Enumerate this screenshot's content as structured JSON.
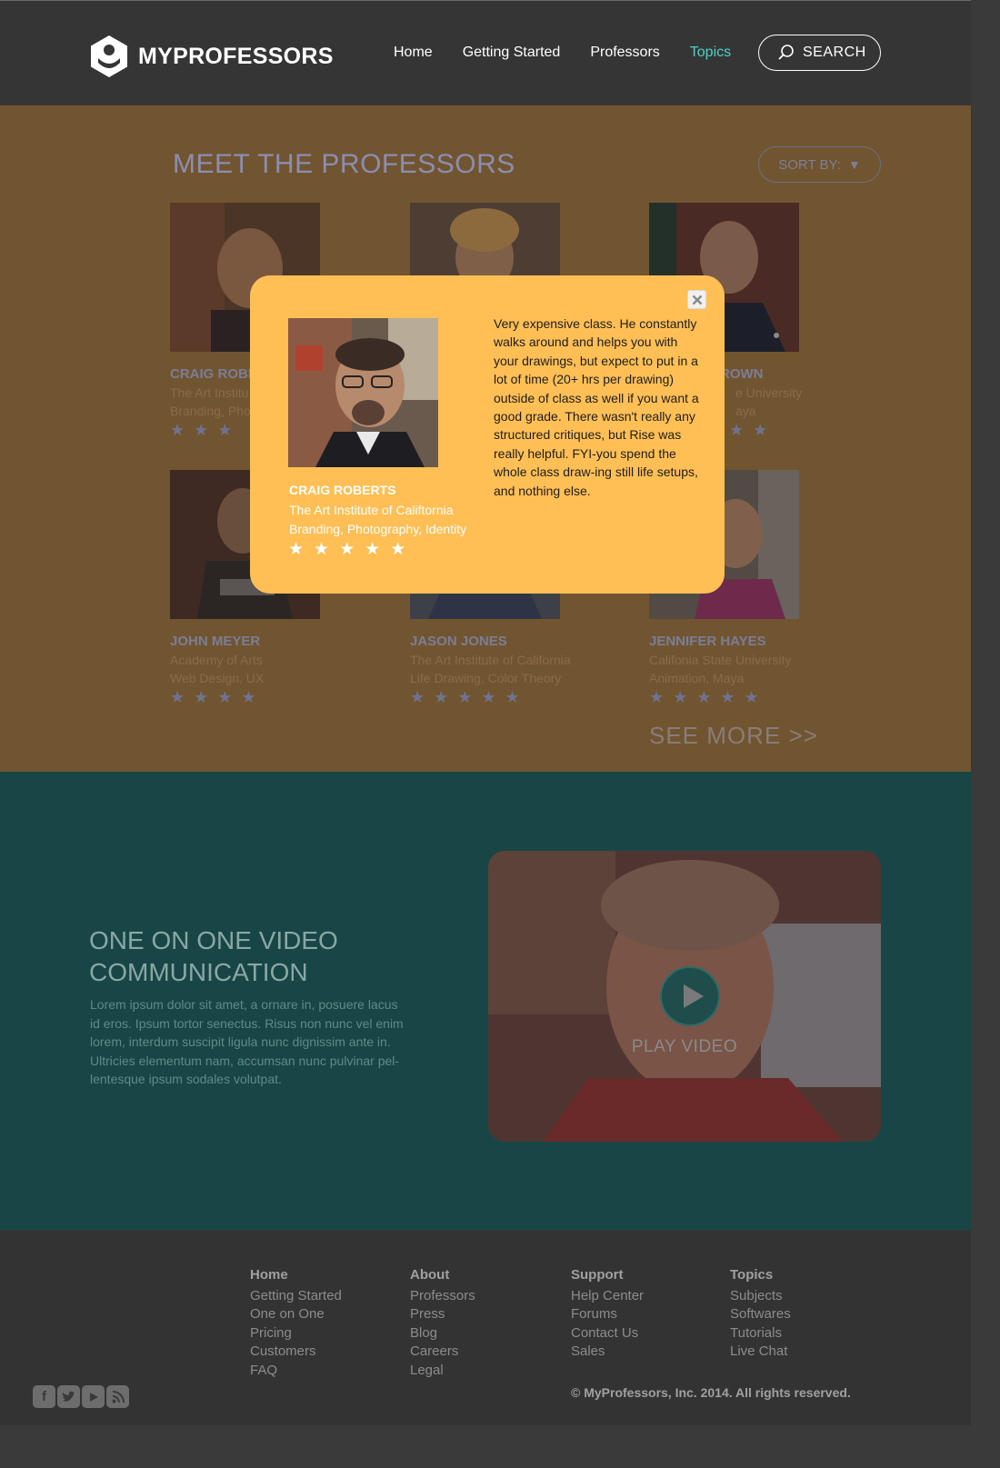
{
  "header": {
    "brand": "MYPROFESSORS",
    "nav": [
      {
        "label": "Home",
        "active": false
      },
      {
        "label": "Getting Started",
        "active": false
      },
      {
        "label": "Professors",
        "active": false
      },
      {
        "label": "Topics",
        "active": true
      }
    ],
    "search_label": "SEARCH"
  },
  "professors": {
    "title": "MEET THE PROFESSORS",
    "sort_label": "SORT BY:",
    "cards": [
      {
        "name": "CRAIG ROBE",
        "school": "The Art Institu",
        "topics": "Branding, Pho",
        "stars": "★★★"
      },
      {
        "name": "",
        "school": "",
        "topics": "",
        "stars": ""
      },
      {
        "name": "ROWN",
        "school": "e University",
        "topics": "aya",
        "stars": "★★"
      },
      {
        "name": "JOHN MEYER",
        "school": "Academy of Arts",
        "topics": "Web Design, UX",
        "stars": "★★★★"
      },
      {
        "name": "JASON JONES",
        "school": "The Art Institute of California",
        "topics": "Life Drawing, Color Theory",
        "stars": "★★★★★"
      },
      {
        "name": "JENNIFER HAYES",
        "school": "Califonia State University",
        "topics": "Animation, Maya",
        "stars": "★★★★★"
      }
    ],
    "see_more": "SEE MORE >>"
  },
  "modal": {
    "name": "CRAIG ROBERTS",
    "school": "The Art Institute of Califtornia",
    "topics": "Branding, Photography, Identity",
    "stars": "★★★★★",
    "rating": 5,
    "review": "Very expensive class. He constantly walks around and helps you with your drawings, but expect to put in a lot of time (20+ hrs per drawing) outside of class as well if you want a good grade. There wasn't really any structured critiques, but Rise was really helpful. FYI-you spend the whole class draw-ing still life setups, and nothing else."
  },
  "video": {
    "title": "ONE ON ONE VIDEO COMMUNICATION",
    "body": "Lorem ipsum dolor sit amet, a ornare in, posuere lacus id eros. Ipsum tortor senectus. Risus non nunc vel enim lorem, interdum suscipit ligula nunc dignissim ante in. Ultricies elementum nam, accumsan nunc pulvinar pel-lentesque ipsum sodales volutpat.",
    "play_label": "PLAY VIDEO"
  },
  "footer": {
    "columns": [
      {
        "heading": "Home",
        "links": [
          "Getting Started",
          "One on One",
          "Pricing",
          "Customers",
          "FAQ"
        ]
      },
      {
        "heading": "About",
        "links": [
          "Professors",
          "Press",
          "Blog",
          "Careers",
          "Legal"
        ]
      },
      {
        "heading": "Support",
        "links": [
          "Help Center",
          "Forums",
          "Contact Us",
          "Sales"
        ]
      },
      {
        "heading": "Topics",
        "links": [
          "Subjects",
          "Softwares",
          "Tutorials",
          "Live Chat"
        ]
      }
    ],
    "copyright": "© MyProfessors, Inc. 2014. All rights reserved.",
    "social_icons": [
      "facebook-icon",
      "twitter-icon",
      "youtube-icon",
      "rss-icon"
    ]
  }
}
